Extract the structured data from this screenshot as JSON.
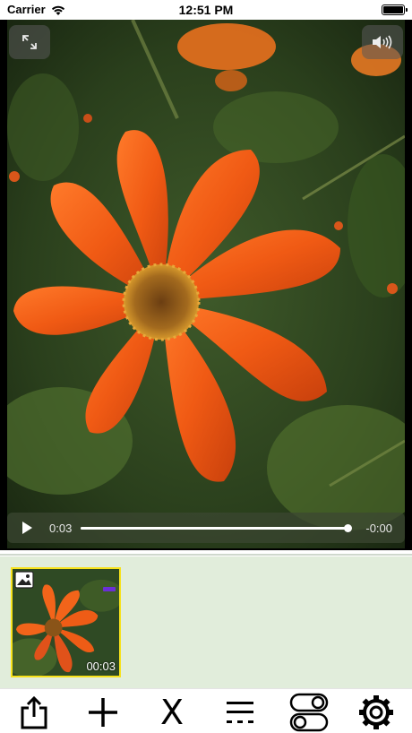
{
  "status_bar": {
    "carrier": "Carrier",
    "time": "12:51 PM",
    "icons": [
      "wifi-icon",
      "battery-icon"
    ]
  },
  "player": {
    "icons": [
      "expand-icon",
      "volume-icon",
      "play-icon"
    ],
    "elapsed": "0:03",
    "remaining": "-0:00",
    "progress": 1.0
  },
  "media_tray": {
    "items": [
      {
        "duration": "00:03",
        "badge": "photo-icon",
        "selected": true
      }
    ],
    "colors": {
      "background": "#e1eddb",
      "selection": "#f7e21b",
      "marker": "#6b2fd6"
    }
  },
  "toolbar": {
    "x_label": "X",
    "icons": [
      "share-icon",
      "add-icon",
      "list-icon",
      "toggles-icon",
      "gear-icon"
    ]
  }
}
